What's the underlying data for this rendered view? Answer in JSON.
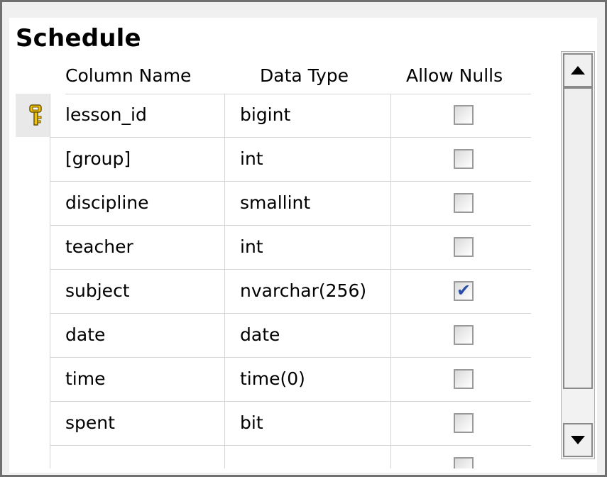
{
  "table": {
    "title": "Schedule",
    "headers": {
      "column_name": "Column Name",
      "data_type": "Data Type",
      "allow_nulls": "Allow Nulls"
    },
    "rows": [
      {
        "name": "lesson_id",
        "type": "bigint",
        "allow_nulls": false,
        "primary_key": true
      },
      {
        "name": "[group]",
        "type": "int",
        "allow_nulls": false,
        "primary_key": false
      },
      {
        "name": "discipline",
        "type": "smallint",
        "allow_nulls": false,
        "primary_key": false
      },
      {
        "name": "teacher",
        "type": "int",
        "allow_nulls": false,
        "primary_key": false
      },
      {
        "name": "subject",
        "type": "nvarchar(256)",
        "allow_nulls": true,
        "primary_key": false
      },
      {
        "name": "date",
        "type": "date",
        "allow_nulls": false,
        "primary_key": false
      },
      {
        "name": "time",
        "type": "time(0)",
        "allow_nulls": false,
        "primary_key": false
      },
      {
        "name": "spent",
        "type": "bit",
        "allow_nulls": false,
        "primary_key": false
      },
      {
        "name": "",
        "type": "",
        "allow_nulls": false,
        "primary_key": false
      }
    ]
  },
  "icons": {
    "primary_key": "key-icon",
    "scroll_up": "triangle-up-icon",
    "scroll_down": "triangle-down-icon",
    "checkmark": "checkmark-icon"
  },
  "colors": {
    "key_icon": "#f2c200",
    "checkmark": "#2b4fa8",
    "grid_line": "#d4d4d4",
    "frame_border": "#707070"
  }
}
